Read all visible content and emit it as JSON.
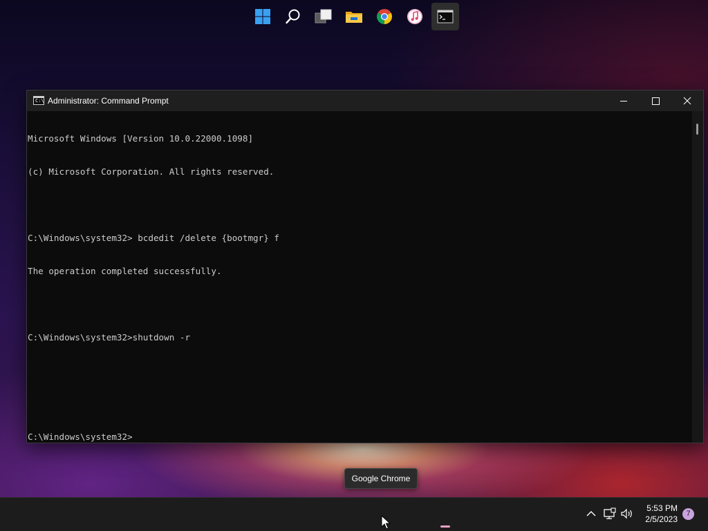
{
  "window": {
    "title": "Administrator: Command Prompt",
    "icon_text": "C:\\"
  },
  "console": {
    "lines": [
      "Microsoft Windows [Version 10.0.22000.1098]",
      "(c) Microsoft Corporation. All rights reserved.",
      "",
      "C:\\Windows\\system32> bcdedit /delete {bootmgr} f",
      "The operation completed successfully.",
      "",
      "C:\\Windows\\system32>shutdown -r",
      "",
      "",
      "C:\\Windows\\system32>"
    ]
  },
  "tooltip": {
    "text": "Google Chrome"
  },
  "taskbar": {
    "icons": [
      "windows-start-icon",
      "search-icon",
      "task-view-icon",
      "file-explorer-icon",
      "chrome-icon",
      "itunes-icon",
      "command-prompt-icon"
    ],
    "active_indicator_color": "#e8a1c6"
  },
  "tray": {
    "time": "5:53 PM",
    "date": "2/5/2023",
    "notification_count": "7"
  },
  "colors": {
    "console_bg": "#0c0c0c",
    "console_text": "#cccccc",
    "taskbar_bg": "#1c1c1c",
    "badge": "#c9a3e0"
  }
}
